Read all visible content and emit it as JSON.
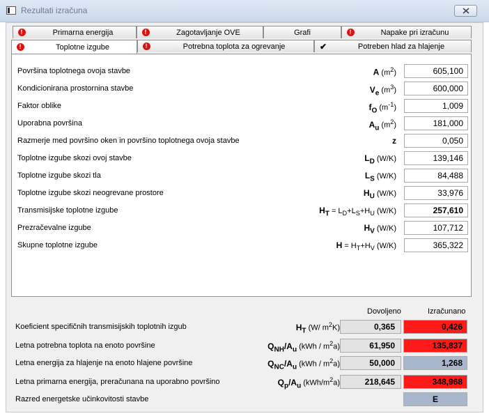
{
  "window": {
    "title": "Rezultati izračuna"
  },
  "tabs_row1": [
    {
      "label": "Primarna energija",
      "indicator": "error"
    },
    {
      "label": "Zagotavljanje OVE",
      "indicator": "error"
    },
    {
      "label": "Grafi",
      "indicator": "none"
    },
    {
      "label": "Napake pri izračunu",
      "indicator": "error"
    }
  ],
  "tabs_row2": [
    {
      "label": "Toplotne izgube",
      "indicator": "error",
      "active": true
    },
    {
      "label": "Potrebna toplota za ogrevanje",
      "indicator": "error"
    },
    {
      "label": "Potreben hlad za hlajenje",
      "indicator": "check"
    }
  ],
  "colors": {
    "error": "#e01010",
    "fail_cell": "#ff1a1a",
    "pass_cell": "#a8b7cc",
    "readonly_cell": "#e3e3e3"
  },
  "losses": [
    {
      "label": "Površina toplotnega ovoja stavbe",
      "symbol": "A",
      "sub": "",
      "formula": "",
      "unit": "(m",
      "unit_sup": "2",
      "unit_end": ")",
      "value": "605,100"
    },
    {
      "label": "Kondicionirana prostornina stavbe",
      "symbol": "V",
      "sub": "e",
      "formula": "",
      "unit": "(m",
      "unit_sup": "3",
      "unit_end": ")",
      "value": "600,000"
    },
    {
      "label": "Faktor oblike",
      "symbol": "f",
      "sub": "O",
      "formula": "",
      "unit": "(m",
      "unit_sup": "-1",
      "unit_end": ")",
      "value": "1,009"
    },
    {
      "label": "Uporabna površina",
      "symbol": "A",
      "sub": "u",
      "formula": "",
      "unit": "(m",
      "unit_sup": "2",
      "unit_end": ")",
      "value": "181,000"
    },
    {
      "label": "Razmerje med površino oken in površino toplotnega ovoja stavbe",
      "symbol": "z",
      "sub": "",
      "formula": "",
      "unit": "",
      "unit_sup": "",
      "unit_end": "",
      "value": "0,050"
    },
    {
      "label": "Toplotne izgube skozi ovoj stavbe",
      "symbol": "L",
      "sub": "D",
      "formula": "",
      "unit": "(W/K)",
      "unit_sup": "",
      "unit_end": "",
      "value": "139,146"
    },
    {
      "label": "Toplotne izgube skozi tla",
      "symbol": "L",
      "sub": "S",
      "formula": "",
      "unit": "(W/K)",
      "unit_sup": "",
      "unit_end": "",
      "value": "84,488"
    },
    {
      "label": "Toplotne izgube skozi neogrevane prostore",
      "symbol": "H",
      "sub": "U",
      "formula": "",
      "unit": "(W/K)",
      "unit_sup": "",
      "unit_end": "",
      "value": "33,976"
    },
    {
      "label": "Transmisijske toplotne izgube",
      "symbol": "H",
      "sub": "T",
      "formula": " = L<sub>D</sub>+L<sub>S</sub>+H<sub>U</sub>",
      "unit": "(W/K)",
      "unit_sup": "",
      "unit_end": "",
      "value": "257,610",
      "bold": true
    },
    {
      "label": "Prezračevalne izgube",
      "symbol": "H",
      "sub": "V",
      "formula": "",
      "unit": "(W/K)",
      "unit_sup": "",
      "unit_end": "",
      "value": "107,712"
    },
    {
      "label": "Skupne toplotne izgube",
      "symbol": "H",
      "sub": "",
      "formula": " = H<sub>T</sub>+H<sub>V</sub>",
      "unit": "(W/K)",
      "unit_sup": "",
      "unit_end": "",
      "value": "365,322"
    }
  ],
  "comparison": {
    "col_allowed": "Dovoljeno",
    "col_calculated": "Izračunano",
    "rows": [
      {
        "label": "Koeficient specifičnih transmisijskih toplotnih izgub",
        "symbol": "H<sub>T</sub>",
        "unit": "(W/ m<sup>2</sup>K)",
        "allowed": "0,365",
        "calculated": "0,426",
        "status": "fail"
      },
      {
        "label": "Letna potrebna toplota na enoto površine",
        "symbol": "Q<sub>NH</sub>/A<sub>u</sub>",
        "unit": "(kWh / m<sup>2</sup>a)",
        "allowed": "61,950",
        "calculated": "135,837",
        "status": "fail"
      },
      {
        "label": "Letna energija za hlajenje na enoto hlajene površine",
        "symbol": "Q<sub>NC</sub>/A<sub>u</sub>",
        "unit": "(kWh / m<sup>2</sup>a)",
        "allowed": "50,000",
        "calculated": "1,268",
        "status": "pass"
      },
      {
        "label": "Letna primarna energija, preračunana na uporabno površino",
        "symbol": "Q<sub>p</sub>/A<sub>u</sub>",
        "unit": "(kWh/m<sup>2</sup>a)",
        "allowed": "218,645",
        "calculated": "348,968",
        "status": "fail"
      }
    ],
    "energy_class": {
      "label": "Razred energetske učinkovitosti stavbe",
      "value": "E"
    }
  }
}
